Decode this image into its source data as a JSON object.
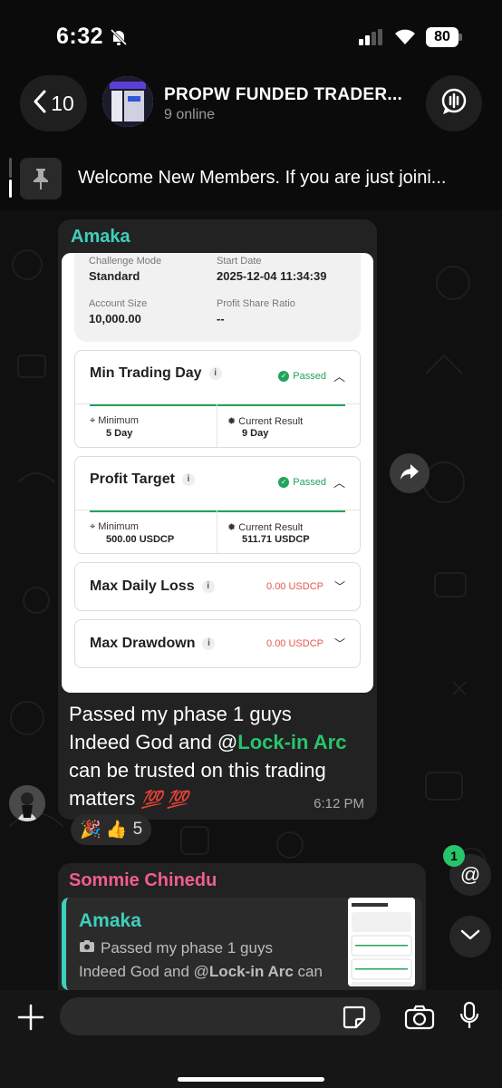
{
  "status_bar": {
    "time": "6:32",
    "battery": "80"
  },
  "header": {
    "back_count": "10",
    "group_name": "PROPW  FUNDED TRADER...",
    "online": "9 online"
  },
  "pinned": {
    "text": "Welcome New Members. If you are just joini..."
  },
  "message1": {
    "sender": "Amaka",
    "sender_color": "#3fcfbd",
    "screenshot": {
      "challenge_mode_label": "Challenge Mode",
      "challenge_mode_value": "Standard",
      "start_date_label": "Start Date",
      "start_date_value": "2025-12-04 11:34:39",
      "account_size_label": "Account Size",
      "account_size_value": "10,000.00",
      "profit_share_label": "Profit Share Ratio",
      "profit_share_value": "--",
      "cards": [
        {
          "title": "Min Trading Day",
          "status": "Passed",
          "min_label": "Minimum",
          "min_value": "5 Day",
          "cur_label": "Current Result",
          "cur_value": "9 Day"
        },
        {
          "title": "Profit Target",
          "status": "Passed",
          "min_label": "Minimum",
          "min_value": "500.00 USDCP",
          "cur_label": "Current Result",
          "cur_value": "511.71 USDCP"
        },
        {
          "title": "Max Daily Loss",
          "value": "0.00 USDCP"
        },
        {
          "title": "Max Drawdown",
          "value": "0.00 USDCP"
        }
      ]
    },
    "caption_line1": "Passed my phase 1 guys",
    "caption_line2_pre": "Indeed God and @",
    "caption_mention": "Lock-in Arc",
    "caption_line3": "can be trusted on this trading",
    "caption_line4": "matters",
    "caption_emoji": "💯 💯",
    "time": "6:12 PM",
    "reactions": {
      "emojis": "🎉 👍",
      "count": "5"
    }
  },
  "message2": {
    "sender": "Sommie Chinedu",
    "sender_color": "#ef5f8a",
    "quote_name": "Amaka",
    "quote_line1": "Passed my phase 1 guys",
    "quote_line2_pre": "Indeed God and @",
    "quote_mention": "Lock-in Arc",
    "quote_line2_post": " can"
  },
  "floating": {
    "mention_badge": "1",
    "mention_symbol": "@"
  },
  "icons": [
    "bell-muted-icon",
    "signal-icon",
    "wifi-icon",
    "chevron-left-icon",
    "voice-chat-icon",
    "pin-icon",
    "share-icon",
    "camera-icon",
    "chevron-down-icon",
    "plus-icon",
    "sticker-icon",
    "mic-icon"
  ]
}
